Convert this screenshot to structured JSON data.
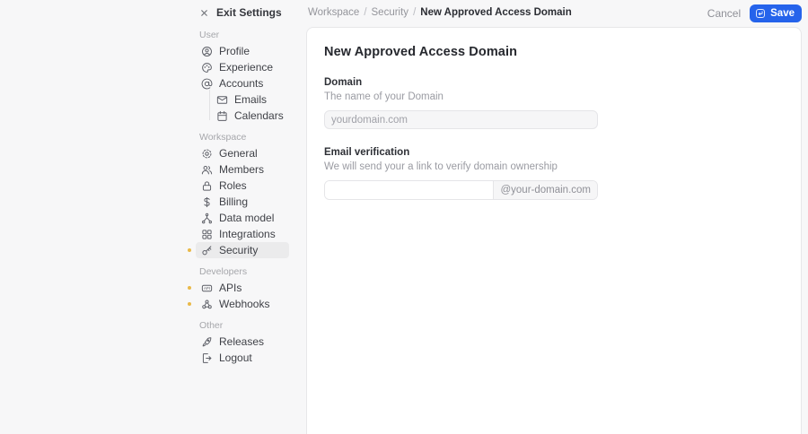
{
  "header": {
    "exit_label": "Exit Settings",
    "breadcrumb": {
      "crumb1": "Workspace",
      "crumb2": "Security",
      "separator": "/",
      "current": "New Approved Access Domain"
    },
    "cancel_label": "Cancel",
    "save_label": "Save"
  },
  "sidebar": {
    "sections": [
      {
        "label": "User",
        "items": [
          {
            "label": "Profile",
            "icon": "user-circle-icon"
          },
          {
            "label": "Experience",
            "icon": "experience-icon"
          },
          {
            "label": "Accounts",
            "icon": "at-sign-icon",
            "children": [
              {
                "label": "Emails",
                "icon": "envelope-icon"
              },
              {
                "label": "Calendars",
                "icon": "calendar-icon"
              }
            ]
          }
        ]
      },
      {
        "label": "Workspace",
        "items": [
          {
            "label": "General",
            "icon": "gear-icon"
          },
          {
            "label": "Members",
            "icon": "users-icon"
          },
          {
            "label": "Roles",
            "icon": "lock-icon"
          },
          {
            "label": "Billing",
            "icon": "dollar-icon"
          },
          {
            "label": "Data model",
            "icon": "branch-icon"
          },
          {
            "label": "Integrations",
            "icon": "grid-icon"
          },
          {
            "label": "Security",
            "icon": "key-icon",
            "active": true,
            "indicator": true
          }
        ]
      },
      {
        "label": "Developers",
        "items": [
          {
            "label": "APIs",
            "icon": "api-chip-icon",
            "indicator": true
          },
          {
            "label": "Webhooks",
            "icon": "webhook-icon",
            "indicator": true
          }
        ]
      },
      {
        "label": "Other",
        "items": [
          {
            "label": "Releases",
            "icon": "rocket-icon"
          },
          {
            "label": "Logout",
            "icon": "logout-icon"
          }
        ]
      }
    ]
  },
  "main": {
    "title": "New Approved Access Domain",
    "fields": [
      {
        "label": "Domain",
        "description": "The name of your Domain",
        "placeholder": "yourdomain.com",
        "value": ""
      },
      {
        "label": "Email verification",
        "description": "We will send your a link to verify domain ownership",
        "value": "",
        "suffix": "@your-domain.com"
      }
    ]
  },
  "colors": {
    "accent": "#2563eb",
    "indicator": "#e9b949",
    "active_item_bg": "#ebebec"
  }
}
